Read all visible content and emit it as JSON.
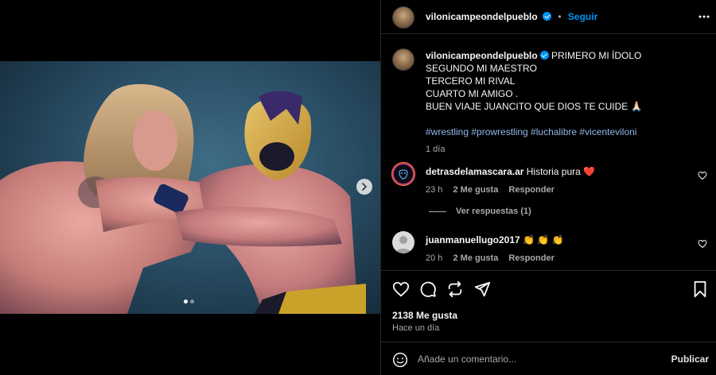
{
  "colors": {
    "background": "#000000",
    "accent_link": "#0095f6",
    "hashtag": "#8fb8e8",
    "muted": "#a8a8a8",
    "verified": "#0095f6",
    "heart_red": "#ff3040"
  },
  "post": {
    "carousel": {
      "total": 2,
      "current": 1
    }
  },
  "header": {
    "username": "vilonicampeondelpueblo",
    "separator": "•",
    "follow_label": "Seguir"
  },
  "caption": {
    "username": "vilonicampeondelpueblo",
    "lines": [
      "PRIMERO MI ÍDOLO",
      "SEGUNDO MI MAESTRO",
      "TERCERO MI RIVAL",
      "CUARTO MI AMIGO .",
      "BUEN VIAJE JUANCITO QUE DIOS TE CUIDE 🙏🏻"
    ],
    "hashtags": "#wrestling #prowrestling #luchalibre #vicenteviloni",
    "time": "1 día"
  },
  "comments": [
    {
      "username": "detrasdelamascara.ar",
      "text": "Historia pura",
      "emoji": "❤️",
      "time": "23 h",
      "likes": "2 Me gusta",
      "reply_label": "Responder",
      "replies_label": "Ver respuestas (1)"
    },
    {
      "username": "juanmanuellugo2017",
      "text": "👏 👏 👏",
      "time": "20 h",
      "likes": "2 Me gusta",
      "reply_label": "Responder"
    }
  ],
  "actions": {
    "icons": [
      "heart-icon",
      "comment-icon",
      "repost-icon",
      "share-icon",
      "bookmark-icon"
    ],
    "likes_count": "2138 Me gusta",
    "posted": "Hace un día"
  },
  "composer": {
    "placeholder": "Añade un comentario...",
    "value": "",
    "post_label": "Publicar"
  }
}
